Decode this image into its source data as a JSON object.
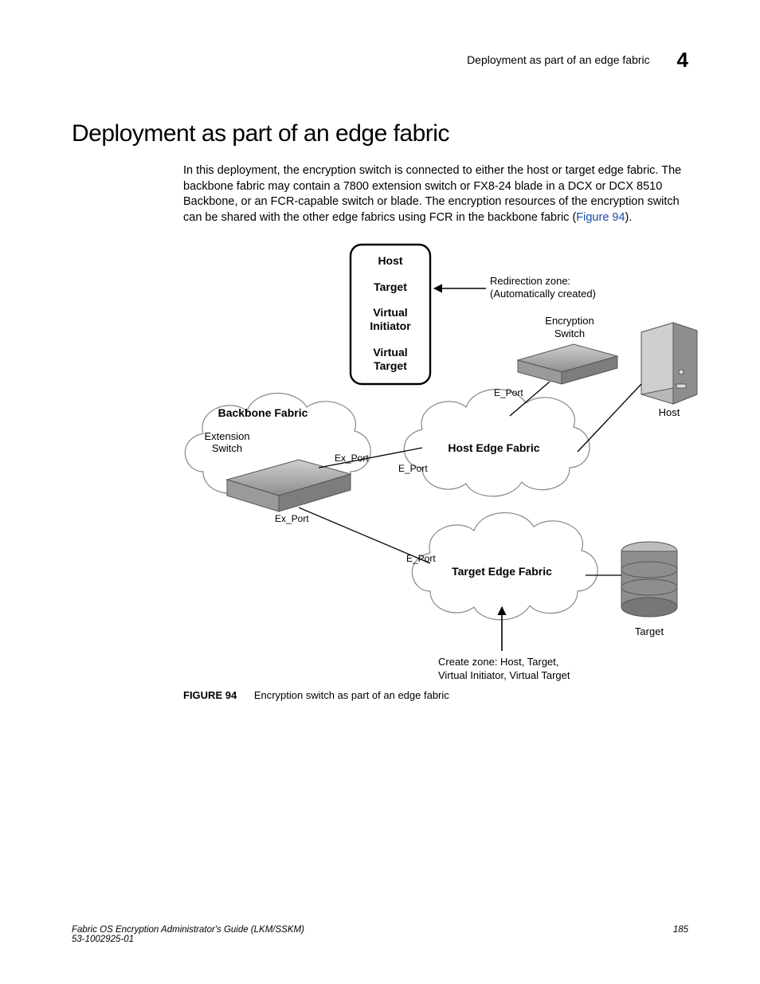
{
  "header": {
    "running_title": "Deployment as part of an edge fabric",
    "chapter_number": "4"
  },
  "section": {
    "title": "Deployment as part of an edge fabric",
    "body": "In this deployment, the encryption switch is connected to either the host or target edge fabric. The backbone fabric may contain a 7800 extension switch or FX8-24 blade in a DCX or DCX 8510 Backbone, or an FCR-capable switch or blade. The encryption resources of the encryption switch can be shared with the other edge fabrics using FCR in the backbone fabric (",
    "xref": "Figure 94",
    "body_tail": ")."
  },
  "figure": {
    "redirection_box": {
      "line1": "Host",
      "line2": "Target",
      "line3": "Virtual",
      "line4": "Initiator",
      "line5": "Virtual",
      "line6": "Target"
    },
    "annotations": {
      "redirection_zone1": "Redirection zone:",
      "redirection_zone2": "(Automatically created)",
      "encryption_switch": "Encryption",
      "encryption_switch2": "Switch",
      "host": "Host",
      "backbone_fabric": "Backbone Fabric",
      "extension_switch1": "Extension",
      "extension_switch2": "Switch",
      "host_edge_fabric": "Host Edge Fabric",
      "target_edge_fabric": "Target Edge Fabric",
      "target": "Target",
      "create_zone1": "Create zone: Host, Target,",
      "create_zone2": "Virtual Initiator, Virtual Target"
    },
    "ports": {
      "ex1": "Ex_Port",
      "ex2": "Ex_Port",
      "e1": "E_Port",
      "e2": "E_Port",
      "e3": "E_Port"
    },
    "caption_label": "FIGURE 94",
    "caption_text": "Encryption switch as part of an edge fabric"
  },
  "footer": {
    "book": "Fabric OS Encryption Administrator's Guide  (LKM/SSKM)",
    "docnum": "53-1002925-01",
    "page": "185"
  }
}
